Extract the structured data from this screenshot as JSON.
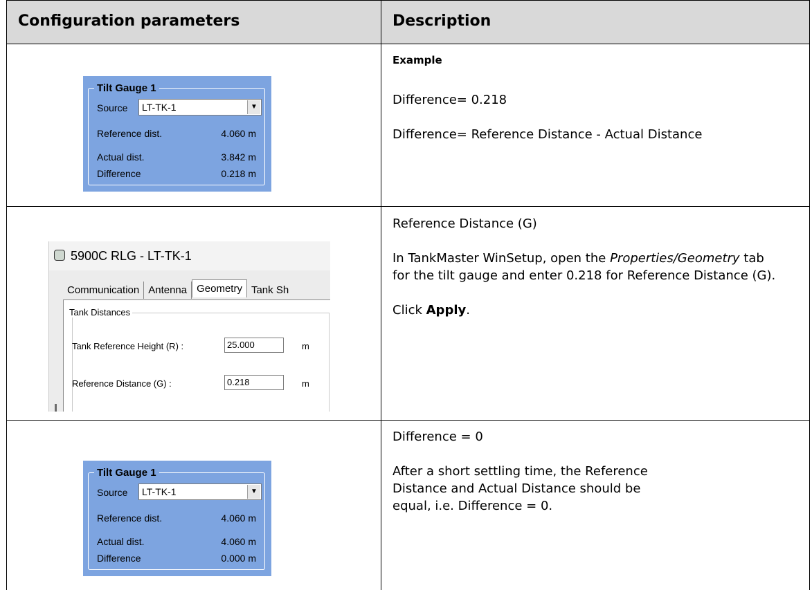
{
  "header": {
    "col1": "Configuration parameters",
    "col2": "Description"
  },
  "row1": {
    "example_label": "Example",
    "line1": "Difference= 0.218",
    "line2": "Difference= Reference Distance - Actual Distance"
  },
  "row2": {
    "line1": "Reference Distance (G)",
    "line2_pre": "In TankMaster WinSetup, open the ",
    "line2_italic": "Properties/Geometry",
    "line2_post": " tab for the tilt gauge and enter 0.218 for Reference Distance (G).",
    "line3_pre": "Click ",
    "line3_bold": "Apply",
    "line3_post": "."
  },
  "row3": {
    "line1": "Difference = 0",
    "line2": "After a short settling time, the Reference Distance and Actual Distance should be equal, i.e. Difference = 0."
  },
  "tilt1": {
    "title": "Tilt Gauge 1",
    "source_label": "Source",
    "source_value": "LT-TK-1",
    "ref_label": "Reference dist.",
    "ref_value": "4.060  m",
    "act_label": "Actual dist.",
    "act_value": "3.842  m",
    "diff_label": "Difference",
    "diff_value": "0.218  m"
  },
  "tilt2": {
    "title": "Tilt Gauge 1",
    "source_label": "Source",
    "source_value": "LT-TK-1",
    "ref_label": "Reference dist.",
    "ref_value": "4.060  m",
    "act_label": "Actual dist.",
    "act_value": "4.060  m",
    "diff_label": "Difference",
    "diff_value": "0.000  m"
  },
  "dialog": {
    "title": "5900C RLG  - LT-TK-1",
    "tabs": [
      "Communication",
      "Antenna",
      "Geometry",
      "Tank Sh"
    ],
    "group_title": "Tank Distances",
    "tank_ref_label": "Tank Reference Height (R) :",
    "tank_ref_value": "25.000",
    "ref_dist_label": "Reference Distance (G) :",
    "ref_dist_value": "0.218",
    "unit": "m"
  }
}
